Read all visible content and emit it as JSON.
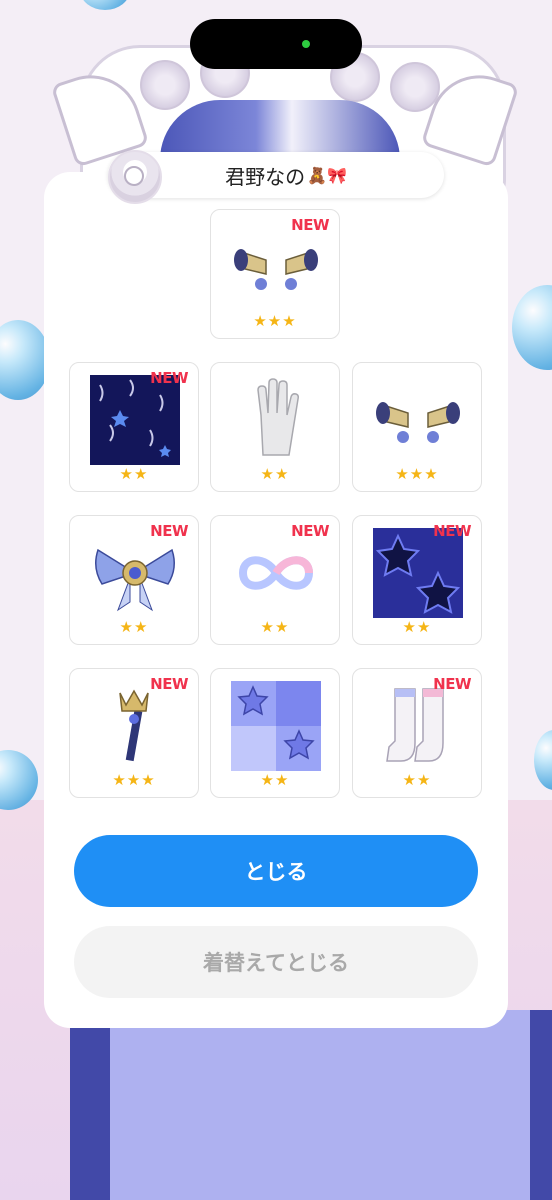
{
  "profile": {
    "name": "君野なの",
    "emoji": "🧸🎀"
  },
  "items": [
    {
      "id": "megaphones-top",
      "new_label": "NEW",
      "stars": "★★★",
      "icon": "megaphone-pair-icon"
    },
    {
      "id": "confetti-bg",
      "new_label": "NEW",
      "stars": "★★",
      "icon": "confetti-background-icon"
    },
    {
      "id": "glove",
      "new_label": "",
      "stars": "★★",
      "icon": "white-glove-icon"
    },
    {
      "id": "megaphones",
      "new_label": "",
      "stars": "★★★",
      "icon": "megaphone-pair-icon"
    },
    {
      "id": "bow-brooch",
      "new_label": "NEW",
      "stars": "★★",
      "icon": "ribbon-bow-icon"
    },
    {
      "id": "infinity",
      "new_label": "NEW",
      "stars": "★★",
      "icon": "infinity-icon"
    },
    {
      "id": "stars-bg",
      "new_label": "NEW",
      "stars": "★★",
      "icon": "star-pattern-background-icon"
    },
    {
      "id": "scepter",
      "new_label": "NEW",
      "stars": "★★★",
      "icon": "crown-scepter-icon"
    },
    {
      "id": "star-tiles",
      "new_label": "",
      "stars": "★★",
      "icon": "star-tile-background-icon"
    },
    {
      "id": "boots",
      "new_label": "NEW",
      "stars": "★★",
      "icon": "white-boots-icon"
    }
  ],
  "buttons": {
    "close": "とじる",
    "change_close": "着替えてとじる"
  },
  "colors": {
    "primary": "#1f8ff5",
    "new_tag": "#f0324d",
    "star": "#f5b516"
  }
}
